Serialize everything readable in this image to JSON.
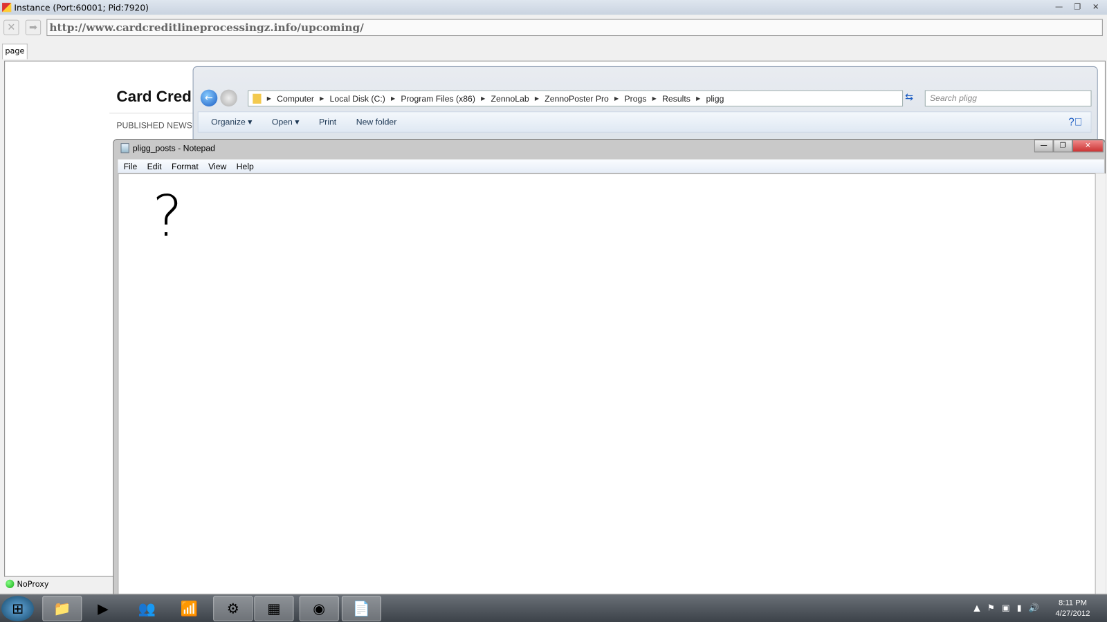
{
  "window": {
    "title": "Instance (Port:60001; Pid:7920)",
    "minimize": "—",
    "maximize": "❐",
    "close": "✕"
  },
  "browser": {
    "url": "http://www.cardcreditlineprocessingz.info/upcoming/",
    "tab_label": "page",
    "status": "NoProxy"
  },
  "site": {
    "title": "Card Cred",
    "subtitle": "PUBLISHED NEWS"
  },
  "explorer": {
    "breadcrumb": [
      "Computer",
      "Local Disk (C:)",
      "Program Files (x86)",
      "ZennoLab",
      "ZennoPoster Pro",
      "Progs",
      "Results",
      "pligg"
    ],
    "search_placeholder": "Search pligg",
    "toolbar": {
      "organize": "Organize ▾",
      "open": "Open ▾",
      "print": "Print",
      "new_folder": "New folder"
    }
  },
  "notepad": {
    "title": "pligg_posts - Notepad",
    "menu": [
      "File",
      "Edit",
      "Format",
      "View",
      "Help"
    ],
    "content": "?"
  },
  "taskbar": {
    "time": "8:11 PM",
    "date": "4/27/2012",
    "items": [
      "start",
      "explorer",
      "media-player",
      "messenger",
      "network",
      "control-panel",
      "paint",
      "chrome",
      "notepad"
    ]
  }
}
